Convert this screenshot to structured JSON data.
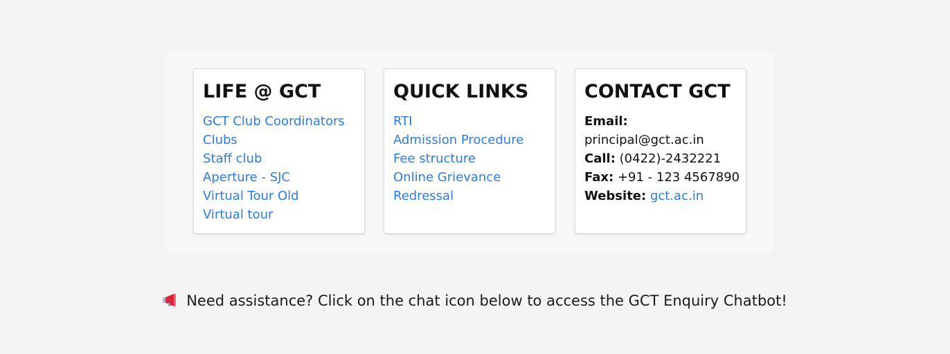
{
  "life": {
    "title": "LIFE @ GCT",
    "links": [
      "GCT Club Coordinators",
      "Clubs",
      "Staff club",
      "Aperture - SJC",
      "Virtual Tour Old",
      "Virtual tour"
    ]
  },
  "quick": {
    "title": "QUICK LINKS",
    "links": [
      "RTI",
      "Admission Procedure",
      "Fee structure",
      "Online Grievance",
      "Redressal"
    ]
  },
  "contact": {
    "title": "CONTACT GCT",
    "email_label": "Email:",
    "email_value": "principal@gct.ac.in",
    "call_label": "Call:",
    "call_value": "(0422)-2432221",
    "fax_label": "Fax:",
    "fax_value": "+91 - 123 4567890",
    "website_label": "Website:",
    "website_value": "gct.ac.in"
  },
  "assistance": {
    "icon": "megaphone-icon",
    "text": "Need assistance? Click on the chat icon below to access the GCT Enquiry Chatbot!"
  },
  "colors": {
    "link": "#2c7be5",
    "background": "#f4f4f4",
    "card": "#ffffff"
  }
}
